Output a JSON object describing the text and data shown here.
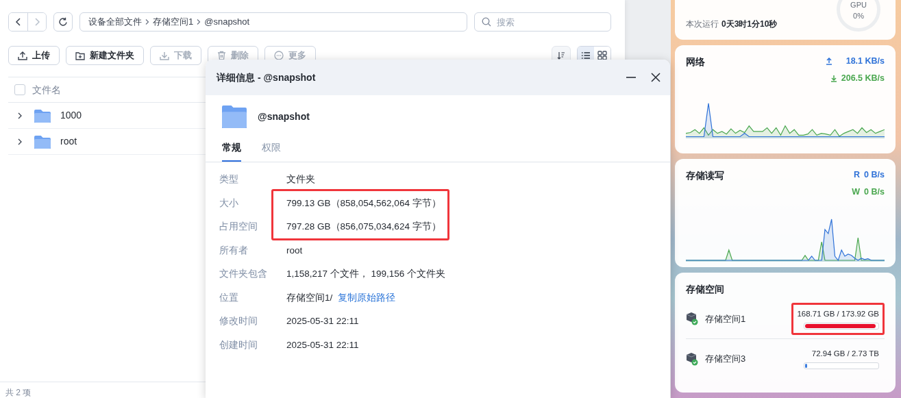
{
  "nav_buttons": [
    {
      "kind": "back",
      "disabled": false
    },
    {
      "kind": "forward",
      "disabled": true
    }
  ],
  "breadcrumb": [
    "设备全部文件",
    "存储空间1",
    "@snapshot"
  ],
  "search": {
    "placeholder": "搜索"
  },
  "actions": [
    {
      "kind": "upload",
      "label": "上传",
      "disabled": false
    },
    {
      "kind": "new-folder",
      "label": "新建文件夹",
      "disabled": false
    },
    {
      "kind": "download",
      "label": "下载",
      "disabled": true
    },
    {
      "kind": "delete",
      "label": "删除",
      "disabled": true
    },
    {
      "kind": "more",
      "label": "更多",
      "disabled": true
    }
  ],
  "view_modes": [
    {
      "kind": "list",
      "selected": true
    },
    {
      "kind": "grid",
      "selected": false
    }
  ],
  "file_list": {
    "select_all": {
      "checked": false
    },
    "column": "文件名",
    "rows": [
      {
        "name": "1000"
      },
      {
        "name": "root"
      }
    ],
    "footer": "共 2 项"
  },
  "details_dialog": {
    "title": "详细信息 - @snapshot",
    "name": "@snapshot",
    "tabs": [
      {
        "label": "常规",
        "selected": true
      },
      {
        "label": "权限",
        "selected": false
      }
    ],
    "rows": [
      {
        "label": "类型",
        "value": "文件夹",
        "highlighted": false
      },
      {
        "label": "大小",
        "value": "799.13 GB（858,054,562,064 字节）",
        "highlighted": true
      },
      {
        "label": "占用空间",
        "value": "797.28 GB（856,075,034,624 字节）",
        "highlighted": true
      },
      {
        "label": "所有者",
        "value": "root",
        "highlighted": false
      },
      {
        "label": "文件夹包含",
        "value": "1,158,217 个文件， 199,156 个文件夹",
        "highlighted": false
      },
      {
        "label": "位置",
        "value": "存储空间1/",
        "link": "复制原始路径",
        "highlighted": false
      },
      {
        "label": "修改时间",
        "value": "2025-05-31 22:11",
        "highlighted": false
      },
      {
        "label": "创建时间",
        "value": "2025-05-31 22:11",
        "highlighted": false
      }
    ]
  },
  "widgets": {
    "system": {
      "gpu_label": "GPU",
      "gpu_value": "0%",
      "uptime_label": "本次运行",
      "uptime": "0天3时1分10秒"
    },
    "network": {
      "title": "网络",
      "upload": "18.1 KB/s",
      "download": "206.5 KB/s"
    },
    "disk_io": {
      "title": "存储读写",
      "read_label": "R",
      "read": "0 B/s",
      "write_label": "W",
      "write": "0 B/s"
    },
    "storage": {
      "title": "存储空间",
      "volumes": [
        {
          "name": "存储空间1",
          "usage": "168.71 GB / 173.92 GB",
          "level": 0.97,
          "color": "#e8112d",
          "highlighted": true
        },
        {
          "name": "存储空间3",
          "usage": "72.94 GB / 2.73 TB",
          "level": 0.026,
          "color": "#3b7de0",
          "highlighted": false
        }
      ]
    }
  }
}
